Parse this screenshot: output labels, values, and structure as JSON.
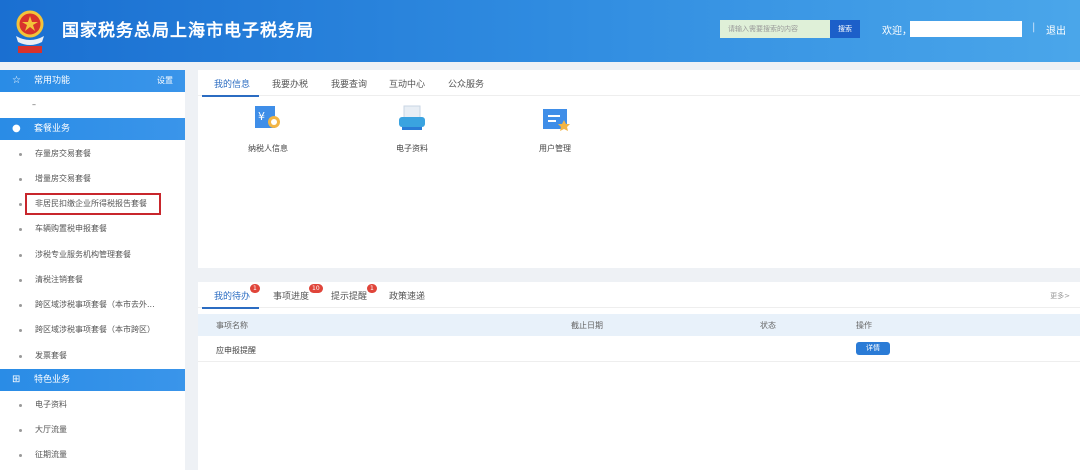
{
  "header": {
    "title": "国家税务总局上海市电子税务局",
    "search_placeholder": "请输入需要搜索的内容",
    "search_button": "搜索",
    "welcome": "欢迎，",
    "separator": "|",
    "logout": "退出"
  },
  "sidebar": {
    "common": {
      "label": "常用功能",
      "settings": "设置",
      "empty": "–"
    },
    "package": {
      "label": "套餐业务",
      "items": [
        "存量房交易套餐",
        "增量房交易套餐",
        "非居民扣缴企业所得税报告套餐",
        "车辆购置税申报套餐",
        "涉税专业服务机构管理套餐",
        "清税注销套餐",
        "跨区域涉税事项套餐（本市去外...",
        "跨区域涉税事项套餐（本市跨区）",
        "发票套餐"
      ]
    },
    "special": {
      "label": "特色业务",
      "items": [
        "电子资料",
        "大厅流量",
        "征期流量"
      ]
    }
  },
  "main": {
    "tabs": [
      "我的信息",
      "我要办税",
      "我要查询",
      "互动中心",
      "公众服务"
    ],
    "services": [
      "纳税人信息",
      "电子资料",
      "用户管理"
    ]
  },
  "todo": {
    "tabs": [
      {
        "label": "我的待办",
        "badge": "1"
      },
      {
        "label": "事项进度",
        "badge": "10"
      },
      {
        "label": "提示提醒",
        "badge": "1"
      },
      {
        "label": "政策速递",
        "badge": null
      }
    ],
    "more": "更多>",
    "columns": [
      "事项名称",
      "截止日期",
      "状态",
      "操作"
    ],
    "rows": [
      {
        "name": "应申报提醒",
        "deadline": "",
        "status": "",
        "action": "详情"
      }
    ]
  }
}
